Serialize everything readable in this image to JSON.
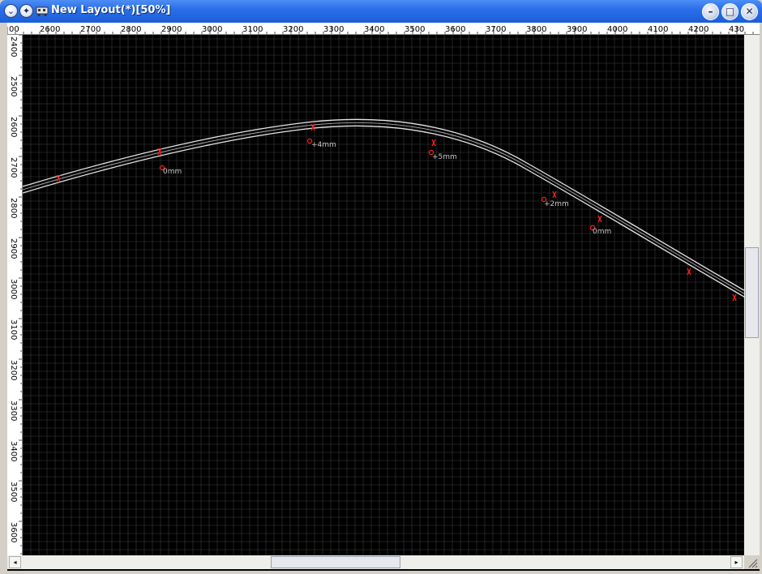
{
  "window": {
    "title": "New Layout(*)[50%]",
    "minimize_label": "–",
    "maximize_label": "□",
    "close_label": "✕",
    "scroll_left_label": "◂",
    "scroll_right_label": "▸"
  },
  "ruler": {
    "horizontal_labels": [
      "00",
      "2600",
      "2700",
      "2800",
      "2900",
      "3000",
      "3100",
      "3200",
      "3300",
      "3400",
      "3500",
      "3600",
      "3700",
      "3800",
      "3900",
      "4000",
      "4100",
      "4200",
      "430"
    ],
    "vertical_labels": [
      "2400",
      "2500",
      "2600",
      "2700",
      "2800",
      "2900",
      "3000",
      "3100",
      "3200",
      "3300",
      "3400",
      "3500",
      "3600"
    ]
  },
  "track": {
    "elevation_labels": [
      "0mm",
      "+4mm",
      "+5mm",
      "+2mm",
      "0mm"
    ]
  },
  "colors": {
    "title_bar": "#2a6fe8",
    "canvas_background": "#000000",
    "grid_line": "#3c3c3c",
    "rail": "#dcdcdc",
    "marker": "#ff2020"
  }
}
